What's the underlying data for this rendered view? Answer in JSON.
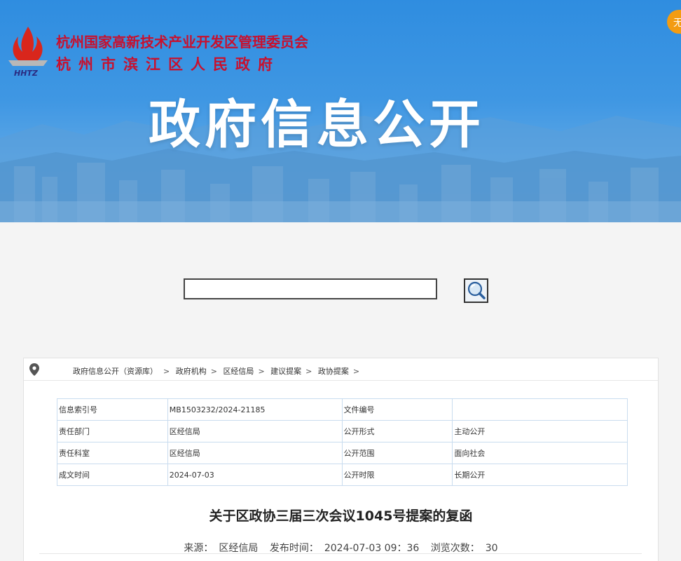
{
  "banner": {
    "org_line1": "杭州国家高新技术产业开发区管理委员会",
    "org_line2": "杭州市滨江区人民政府",
    "logo_text": "HHTZ",
    "title": "政府信息公开",
    "corner_badge": "无",
    "colors": {
      "sky": "#3f97e3",
      "org_text": "#c8102e",
      "accent": "#f39c12"
    }
  },
  "search": {
    "input_value": "",
    "placeholder": "",
    "button_icon": "magnifier-icon"
  },
  "breadcrumb": {
    "icon": "location-pin-icon",
    "items": [
      "政府信息公开（资源库）",
      "政府机构",
      "区经信局",
      "建议提案",
      "政协提案"
    ],
    "separator": ">"
  },
  "meta_table": [
    [
      "信息索引号",
      "MB1503232/2024-21185",
      "文件编号",
      ""
    ],
    [
      "责任部门",
      "区经信局",
      "公开形式",
      "主动公开"
    ],
    [
      "责任科室",
      "区经信局",
      "公开范围",
      "面向社会"
    ],
    [
      "成文时间",
      "2024-07-03",
      "公开时限",
      "长期公开"
    ]
  ],
  "document": {
    "title": "关于区政协三届三次会议1045号提案的复函",
    "source_label": "来源：",
    "source_value": "区经信局",
    "publish_label": "发布时间：",
    "publish_value": "2024-07-03 09：36",
    "views_label": "浏览次数：",
    "views_value": "30"
  }
}
